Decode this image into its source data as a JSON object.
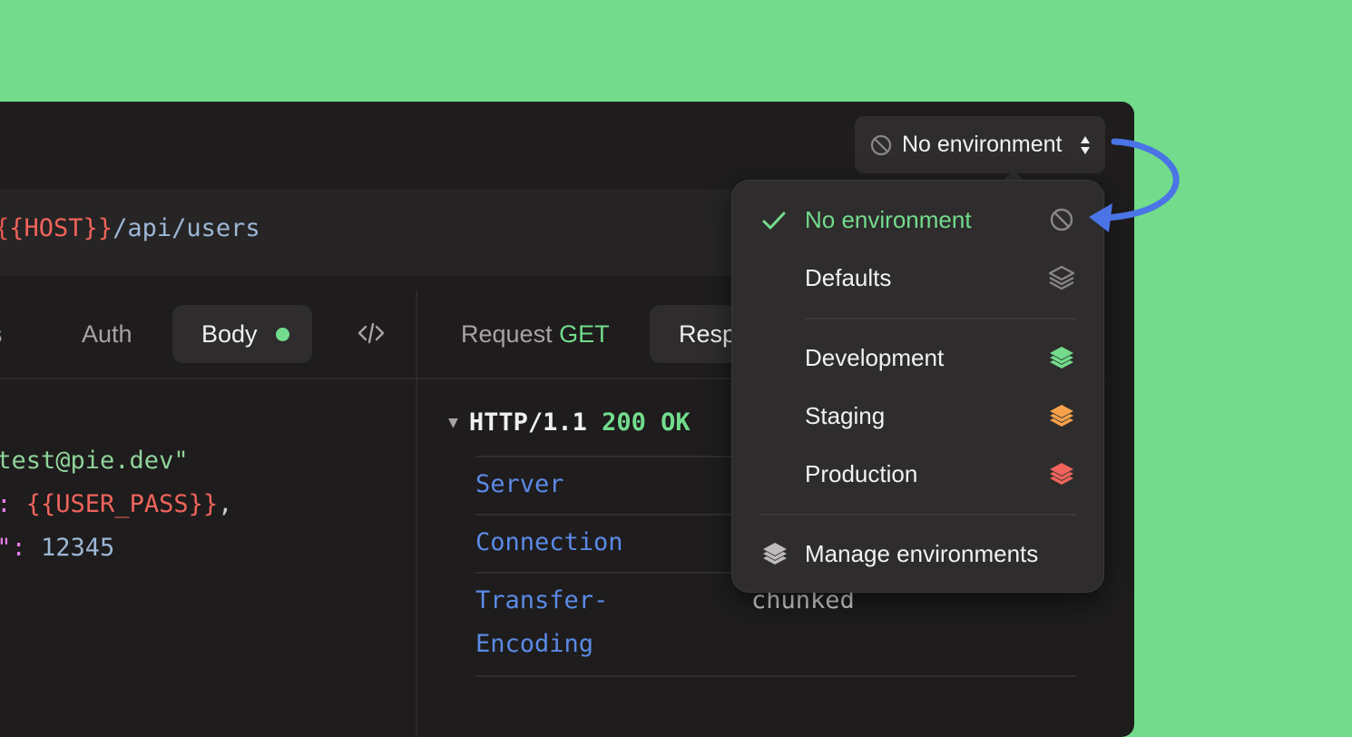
{
  "env_selector": {
    "label": "No environment"
  },
  "url": {
    "brace_open": "{",
    "var_open": "{",
    "var": "HOST",
    "var_close": "}}",
    "path": "/api/users"
  },
  "left_tabs": {
    "headers_fragment": "rs",
    "auth": "Auth",
    "body": "Body"
  },
  "right_tabs": {
    "request": "Request",
    "method": "GET",
    "response": "Resp"
  },
  "code": {
    "line1": "\"test@pie.dev\"",
    "line2_key": "\": ",
    "line2_val": "{{USER_PASS}}",
    "line2_end": ",",
    "line3_key": "d\": ",
    "line3_val": "12345"
  },
  "response": {
    "protocol": "HTTP/1.1",
    "status": "200 OK",
    "headers": [
      {
        "name": "Server",
        "value": ""
      },
      {
        "name": "Connection",
        "value": ""
      },
      {
        "name": "Transfer-",
        "name2": "Encoding",
        "value": "chunked"
      }
    ]
  },
  "menu": {
    "items": [
      {
        "label": "No environment",
        "selected": true,
        "icon": "no-environment-icon"
      },
      {
        "label": "Defaults",
        "icon": "layers-icon",
        "color": "#8a8787"
      },
      {
        "label": "Development",
        "icon": "layers-icon",
        "color": "#72dc8c"
      },
      {
        "label": "Staging",
        "icon": "layers-icon",
        "color": "#f5a24a"
      },
      {
        "label": "Production",
        "icon": "layers-icon",
        "color": "#f0645c"
      }
    ],
    "manage": "Manage environments"
  },
  "colors": {
    "background": "#72dc8c",
    "window": "#1e1c1c",
    "accent_green": "#72dc8c",
    "arrow": "#4a74e6"
  }
}
